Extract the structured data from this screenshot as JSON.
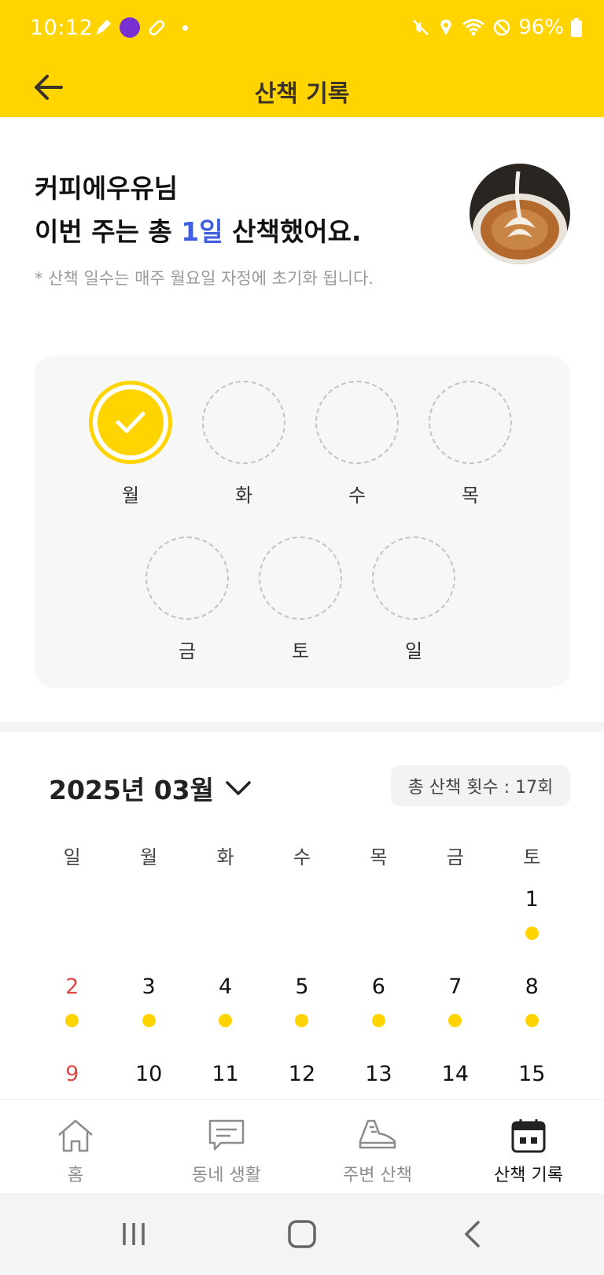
{
  "status": {
    "time": "10:12",
    "battery": "96%"
  },
  "appbar": {
    "title": "산책 기록"
  },
  "greeting": {
    "name_line": "커피에우유님",
    "summary_prefix": "이번 주는 총 ",
    "summary_count": "1일",
    "summary_suffix": " 산책했어요.",
    "note": "* 산책 일수는 매주 월요일 자정에 초기화 됩니다."
  },
  "week": {
    "days": [
      {
        "label": "월",
        "done": true
      },
      {
        "label": "화",
        "done": false
      },
      {
        "label": "수",
        "done": false
      },
      {
        "label": "목",
        "done": false
      },
      {
        "label": "금",
        "done": false
      },
      {
        "label": "토",
        "done": false
      },
      {
        "label": "일",
        "done": false
      }
    ]
  },
  "calendar": {
    "month_label": "2025년 03월",
    "total_label": "총 산책 횟수 : 17회",
    "weekdays": [
      "일",
      "월",
      "화",
      "수",
      "목",
      "금",
      "토"
    ],
    "rows": [
      [
        "",
        "",
        "",
        "",
        "",
        "",
        "1"
      ],
      [
        "2",
        "3",
        "4",
        "5",
        "6",
        "7",
        "8"
      ],
      [
        "9",
        "10",
        "11",
        "12",
        "13",
        "14",
        "15"
      ]
    ],
    "walked": [
      [
        false,
        false,
        false,
        false,
        false,
        false,
        true
      ],
      [
        true,
        true,
        true,
        true,
        true,
        true,
        true
      ],
      [
        false,
        false,
        false,
        false,
        false,
        false,
        false
      ]
    ]
  },
  "nav": {
    "items": [
      {
        "label": "홈",
        "icon": "home-icon",
        "active": false
      },
      {
        "label": "동네 생활",
        "icon": "chat-icon",
        "active": false
      },
      {
        "label": "주변 산책",
        "icon": "sneaker-icon",
        "active": false
      },
      {
        "label": "산책 기록",
        "icon": "calendar-icon",
        "active": true
      }
    ]
  },
  "colors": {
    "accent": "#FFD400",
    "highlight": "#3f5fe0",
    "sunday": "#e04646"
  }
}
